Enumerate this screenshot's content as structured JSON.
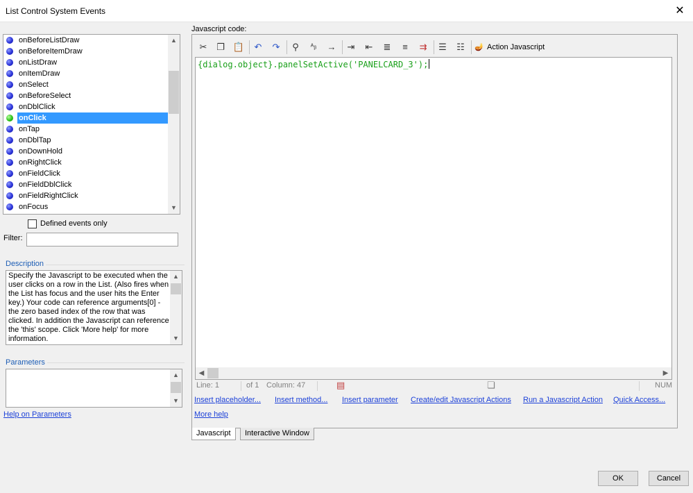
{
  "window": {
    "title": "List Control System Events",
    "close_glyph": "✕"
  },
  "events": {
    "items": [
      {
        "label": "onBeforeListDraw",
        "defined": false
      },
      {
        "label": "onBeforeItemDraw",
        "defined": false
      },
      {
        "label": "onListDraw",
        "defined": false
      },
      {
        "label": "onItemDraw",
        "defined": false
      },
      {
        "label": "onSelect",
        "defined": false
      },
      {
        "label": "onBeforeSelect",
        "defined": false
      },
      {
        "label": "onDblClick",
        "defined": false
      },
      {
        "label": "onClick",
        "defined": true,
        "selected": true
      },
      {
        "label": "onTap",
        "defined": false
      },
      {
        "label": "onDblTap",
        "defined": false
      },
      {
        "label": "onDownHold",
        "defined": false
      },
      {
        "label": "onRightClick",
        "defined": false
      },
      {
        "label": "onFieldClick",
        "defined": false
      },
      {
        "label": "onFieldDblClick",
        "defined": false
      },
      {
        "label": "onFieldRightClick",
        "defined": false
      },
      {
        "label": "onFocus",
        "defined": false
      }
    ]
  },
  "defined_only": {
    "label": "Defined events only",
    "checked": false
  },
  "filter": {
    "label": "Filter:",
    "value": ""
  },
  "description": {
    "title": "Description",
    "text": "Specify the Javascript to be executed when the user clicks on a row in the List. (Also fires when the List has focus and the user hits the Enter key.)  Your code can reference arguments[0]  - the zero based index of the row that was clicked. In addition the Javascript can reference the 'this' scope. Click 'More help' for more information."
  },
  "parameters": {
    "title": "Parameters",
    "help_link": "Help on Parameters"
  },
  "editor": {
    "label": "Javascript code:",
    "code": "{dialog.object}.panelSetActive('PANELCARD_3');",
    "action_button": "Action Javascript",
    "status": {
      "line": "Line: 1",
      "of": "of 1",
      "column": "Column: 47",
      "num": "NUM"
    }
  },
  "links": {
    "insert_placeholder": "Insert placeholder...",
    "insert_method": "Insert method...",
    "insert_parameter": "Insert parameter",
    "create_edit": "Create/edit Javascript Actions",
    "run_action": "Run a Javascript Action",
    "quick_access": "Quick Access...",
    "more_help": "More help"
  },
  "tabs": {
    "javascript": "Javascript",
    "interactive": "Interactive Window"
  },
  "buttons": {
    "ok": "OK",
    "cancel": "Cancel"
  },
  "colors": {
    "selection": "#3399ff",
    "link": "#1a3fd8",
    "code": "#1aa01a",
    "group_label": "#1c5db5"
  }
}
